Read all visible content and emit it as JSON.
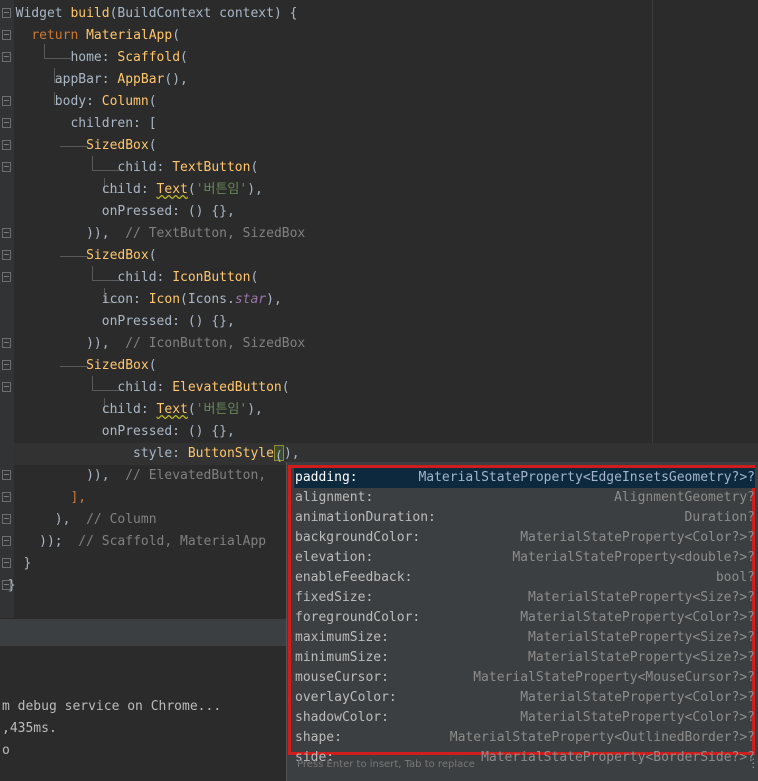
{
  "editor": {
    "lines": [
      {
        "parts": [
          {
            "t": "  Widget ",
            "c": "param"
          },
          {
            "t": "build",
            "c": "fn"
          },
          {
            "t": "(BuildContext context) {",
            "c": "param"
          }
        ]
      },
      {
        "parts": [
          {
            "t": "    ",
            "c": "param"
          },
          {
            "t": "return ",
            "c": "kw"
          },
          {
            "t": "MaterialApp",
            "c": "fn"
          },
          {
            "t": "(",
            "c": "param"
          }
        ]
      },
      {
        "parts": [
          {
            "t": "         home: ",
            "c": "param"
          },
          {
            "t": "Scaffold",
            "c": "fn"
          },
          {
            "t": "(",
            "c": "param"
          }
        ]
      },
      {
        "parts": [
          {
            "t": "       appBar: ",
            "c": "param"
          },
          {
            "t": "AppBar",
            "c": "fn"
          },
          {
            "t": "(),",
            "c": "param"
          }
        ]
      },
      {
        "parts": [
          {
            "t": "       body: ",
            "c": "param"
          },
          {
            "t": "Column",
            "c": "fn"
          },
          {
            "t": "(",
            "c": "param"
          }
        ]
      },
      {
        "parts": [
          {
            "t": "         children: [",
            "c": "param"
          }
        ]
      },
      {
        "parts": [
          {
            "t": "           ",
            "c": "param"
          },
          {
            "t": "SizedBox",
            "c": "fn"
          },
          {
            "t": "(",
            "c": "param"
          }
        ]
      },
      {
        "parts": [
          {
            "t": "               child: ",
            "c": "param"
          },
          {
            "t": "TextButton",
            "c": "fn"
          },
          {
            "t": "(",
            "c": "param"
          }
        ]
      },
      {
        "parts": [
          {
            "t": "             child: ",
            "c": "param"
          },
          {
            "t": "Text",
            "c": "fn"
          },
          {
            "t": "(",
            "c": "param"
          },
          {
            "t": "'버튼임'",
            "c": "str"
          },
          {
            "t": "),",
            "c": "param"
          }
        ]
      },
      {
        "parts": [
          {
            "t": "             onPressed: () {},",
            "c": "param"
          }
        ]
      },
      {
        "parts": [
          {
            "t": "           )),  ",
            "c": "param"
          },
          {
            "t": "// TextButton, SizedBox",
            "c": "cm"
          }
        ]
      },
      {
        "parts": [
          {
            "t": "           ",
            "c": "param"
          },
          {
            "t": "SizedBox",
            "c": "fn"
          },
          {
            "t": "(",
            "c": "param"
          }
        ]
      },
      {
        "parts": [
          {
            "t": "               child: ",
            "c": "param"
          },
          {
            "t": "IconButton",
            "c": "fn"
          },
          {
            "t": "(",
            "c": "param"
          }
        ]
      },
      {
        "parts": [
          {
            "t": "             icon: ",
            "c": "param"
          },
          {
            "t": "Icon",
            "c": "fn"
          },
          {
            "t": "(Icons.",
            "c": "param"
          },
          {
            "t": "star",
            "c": "it"
          },
          {
            "t": "),",
            "c": "param"
          }
        ]
      },
      {
        "parts": [
          {
            "t": "             onPressed: () {},",
            "c": "param"
          }
        ]
      },
      {
        "parts": [
          {
            "t": "           )),  ",
            "c": "param"
          },
          {
            "t": "// IconButton, SizedBox",
            "c": "cm"
          }
        ]
      },
      {
        "parts": [
          {
            "t": "           ",
            "c": "param"
          },
          {
            "t": "SizedBox",
            "c": "fn"
          },
          {
            "t": "(",
            "c": "param"
          }
        ]
      },
      {
        "parts": [
          {
            "t": "               child: ",
            "c": "param"
          },
          {
            "t": "ElevatedButton",
            "c": "fn"
          },
          {
            "t": "(",
            "c": "param"
          }
        ]
      },
      {
        "parts": [
          {
            "t": "             child: ",
            "c": "param"
          },
          {
            "t": "Text",
            "c": "fn"
          },
          {
            "t": "(",
            "c": "param"
          },
          {
            "t": "'버튼임'",
            "c": "str"
          },
          {
            "t": "),",
            "c": "param"
          }
        ]
      },
      {
        "parts": [
          {
            "t": "             onPressed: () {},",
            "c": "param"
          }
        ]
      },
      {
        "parts": [
          {
            "t": "                 style: ",
            "c": "param"
          },
          {
            "t": "ButtonStyle",
            "c": "fn"
          },
          {
            "t": "(",
            "c": "cursor"
          },
          {
            "t": "),",
            "c": "param"
          }
        ]
      },
      {
        "parts": [
          {
            "t": "           )),  ",
            "c": "param"
          },
          {
            "t": "// ElevatedButton,",
            "c": "cm"
          }
        ]
      },
      {
        "parts": [
          {
            "t": "         ],",
            "c": "kw"
          }
        ]
      },
      {
        "parts": [
          {
            "t": "       ),  ",
            "c": "param"
          },
          {
            "t": "// Column",
            "c": "cm"
          }
        ]
      },
      {
        "parts": [
          {
            "t": "     ));  ",
            "c": "param"
          },
          {
            "t": "// Scaffold, MaterialApp",
            "c": "cm"
          }
        ]
      },
      {
        "parts": [
          {
            "t": "   }",
            "c": "param"
          }
        ]
      },
      {
        "parts": [
          {
            "t": " }",
            "c": "param"
          }
        ]
      }
    ]
  },
  "console": {
    "lines": [
      "m debug service on Chrome...",
      ",435ms.",
      "o"
    ]
  },
  "completion": {
    "items": [
      {
        "name": "padding:",
        "type": "MaterialStateProperty<EdgeInsetsGeometry?>?",
        "selected": true
      },
      {
        "name": "alignment:",
        "type": "AlignmentGeometry?"
      },
      {
        "name": "animationDuration:",
        "type": "Duration?"
      },
      {
        "name": "backgroundColor:",
        "type": "MaterialStateProperty<Color?>?"
      },
      {
        "name": "elevation:",
        "type": "MaterialStateProperty<double?>?"
      },
      {
        "name": "enableFeedback:",
        "type": "bool?"
      },
      {
        "name": "fixedSize:",
        "type": "MaterialStateProperty<Size?>?"
      },
      {
        "name": "foregroundColor:",
        "type": "MaterialStateProperty<Color?>?"
      },
      {
        "name": "maximumSize:",
        "type": "MaterialStateProperty<Size?>?"
      },
      {
        "name": "minimumSize:",
        "type": "MaterialStateProperty<Size?>?"
      },
      {
        "name": "mouseCursor:",
        "type": "MaterialStateProperty<MouseCursor?>?"
      },
      {
        "name": "overlayColor:",
        "type": "MaterialStateProperty<Color?>?"
      },
      {
        "name": "shadowColor:",
        "type": "MaterialStateProperty<Color?>?"
      },
      {
        "name": "shape:",
        "type": "MaterialStateProperty<OutlinedBorder?>?"
      },
      {
        "name": "side:",
        "type": "MaterialStateProperty<BorderSide?>?"
      }
    ],
    "footer": "Press Enter to insert, Tab to replace",
    "more_icon": "vertical-ellipsis-icon"
  },
  "colors": {
    "keyword": "#cc7832",
    "function": "#ffc66d",
    "string": "#6a8759",
    "comment": "#808080",
    "highlight_border": "#d11c1c",
    "selection": "#0d293e"
  }
}
